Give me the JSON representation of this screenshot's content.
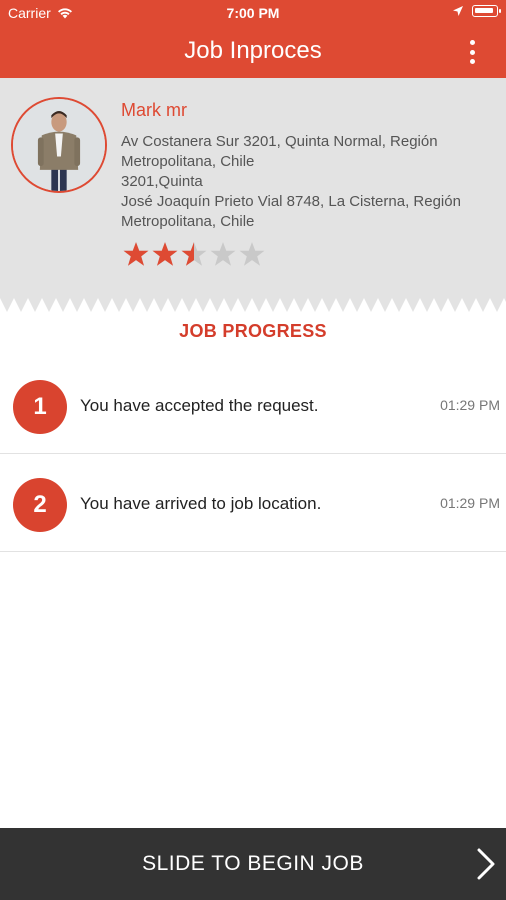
{
  "status_bar": {
    "carrier": "Carrier",
    "time": "7:00 PM"
  },
  "navbar": {
    "title": "Job Inproces",
    "menu_icon": "more-vertical-icon"
  },
  "profile": {
    "name": "Mark mr",
    "address_lines": [
      "Av Costanera Sur 3201, Quinta Normal, Región Metropolitana, Chile",
      "3201,Quinta",
      "José Joaquín Prieto Vial 8748,  La Cisterna, Región Metropolitana,  Chile"
    ],
    "rating": 2.5,
    "rating_max": 5
  },
  "job_progress": {
    "title": "JOB PROGRESS",
    "steps": [
      {
        "number": "1",
        "text": "You have accepted the request.",
        "time": "01:29 PM"
      },
      {
        "number": "2",
        "text": "You have arrived to job location.",
        "time": "01:29 PM"
      }
    ]
  },
  "slide": {
    "label": "SLIDE TO BEGIN JOB",
    "icon": "chevron-right-icon"
  },
  "colors": {
    "accent": "#de4a33",
    "profile_bg": "#e3e3e3",
    "slide_bg": "#333333",
    "star_empty": "#c9c9c9"
  }
}
